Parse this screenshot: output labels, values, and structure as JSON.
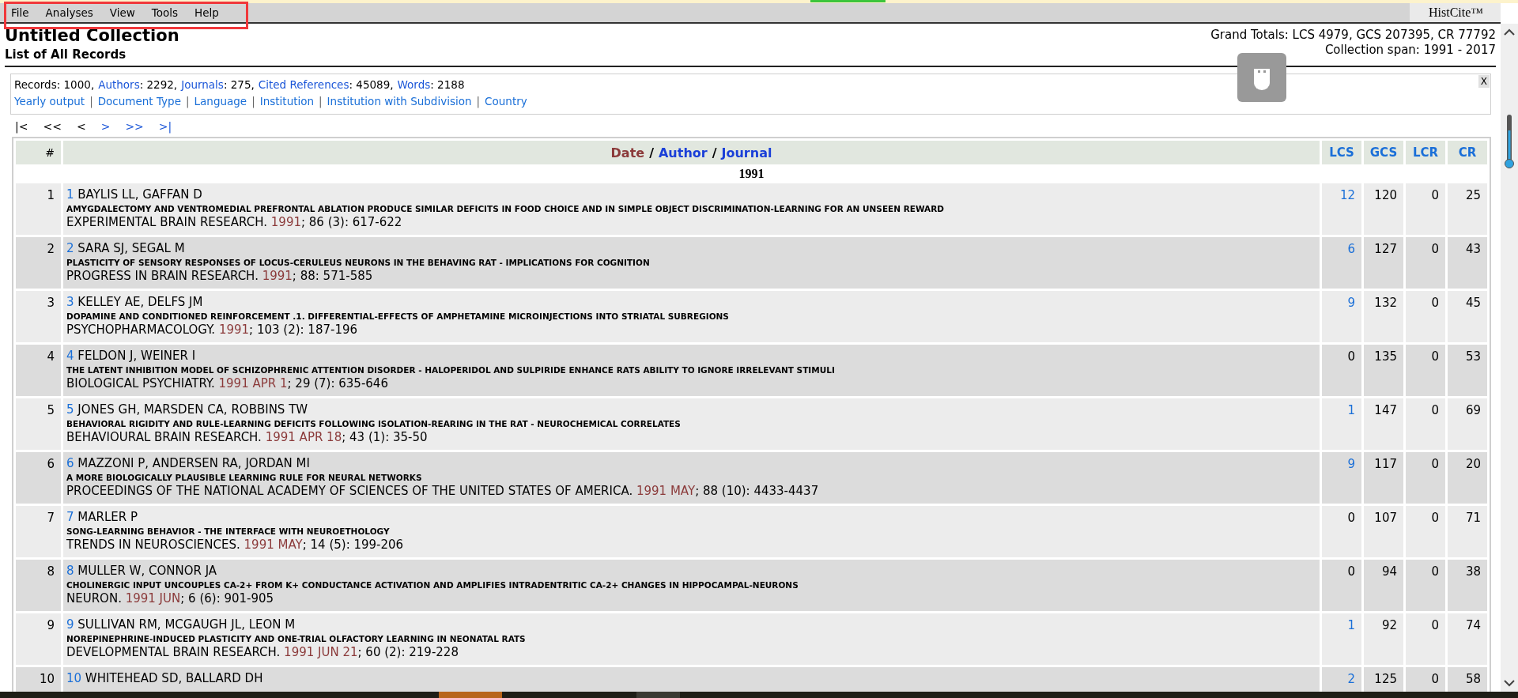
{
  "menu": [
    "File",
    "Analyses",
    "View",
    "Tools",
    "Help"
  ],
  "app_name": "HistCite™",
  "title": "Untitled Collection",
  "subtitle": "List of All Records",
  "grand_totals": "Grand Totals: LCS 4979, GCS 207395, CR 77792",
  "collection_span": "Collection span: 1991 - 2017",
  "summary": [
    {
      "label": "Records",
      "value": ": 1000,",
      "link": false
    },
    {
      "label": "Authors",
      "value": ": 2292,",
      "link": true
    },
    {
      "label": "Journals",
      "value": ": 275,",
      "link": true
    },
    {
      "label": "Cited References",
      "value": ": 45089,",
      "link": true
    },
    {
      "label": "Words",
      "value": ": 2188",
      "link": true
    }
  ],
  "view_separator": "|",
  "sort_separator": "/",
  "views": [
    "Yearly output",
    "Document Type",
    "Language",
    "Institution",
    "Institution with Subdivision",
    "Country"
  ],
  "close_label": "X",
  "pager": [
    {
      "label": "|<",
      "enabled": false
    },
    {
      "label": "<<",
      "enabled": false
    },
    {
      "label": "<",
      "enabled": false
    },
    {
      "label": ">",
      "enabled": true
    },
    {
      "label": ">>",
      "enabled": true
    },
    {
      "label": ">|",
      "enabled": true
    }
  ],
  "table": {
    "number_header": "#",
    "sort_keys": [
      {
        "label": "Date",
        "selected": true
      },
      {
        "label": "Author",
        "selected": false
      },
      {
        "label": "Journal",
        "selected": false
      }
    ],
    "metric_headers": [
      "LCS",
      "GCS",
      "LCR",
      "CR"
    ],
    "group": "1991",
    "rows": [
      {
        "num": "1",
        "id": "1",
        "authors": "BAYLIS LL, GAFFAN D",
        "title": "AMYGDALECTOMY AND VENTROMEDIAL PREFRONTAL ABLATION PRODUCE SIMILAR DEFICITS IN FOOD CHOICE AND IN SIMPLE OBJECT DISCRIMINATION-LEARNING FOR AN UNSEEN REWARD",
        "journal": "EXPERIMENTAL BRAIN RESEARCH.",
        "date": "1991",
        "pages": "; 86 (3): 617-622",
        "lcs": "12",
        "lcs_linked": true,
        "gcs": "120",
        "lcr": "0",
        "cr": "25"
      },
      {
        "num": "2",
        "id": "2",
        "authors": "SARA SJ, SEGAL M",
        "title": "PLASTICITY OF SENSORY RESPONSES OF LOCUS-CERULEUS NEURONS IN THE BEHAVING RAT - IMPLICATIONS FOR COGNITION",
        "journal": "PROGRESS IN BRAIN RESEARCH.",
        "date": "1991",
        "pages": "; 88: 571-585",
        "lcs": "6",
        "lcs_linked": true,
        "gcs": "127",
        "lcr": "0",
        "cr": "43"
      },
      {
        "num": "3",
        "id": "3",
        "authors": "KELLEY AE, DELFS JM",
        "title": "DOPAMINE AND CONDITIONED REINFORCEMENT .1. DIFFERENTIAL-EFFECTS OF AMPHETAMINE MICROINJECTIONS INTO STRIATAL SUBREGIONS",
        "journal": "PSYCHOPHARMACOLOGY.",
        "date": "1991",
        "pages": "; 103 (2): 187-196",
        "lcs": "9",
        "lcs_linked": true,
        "gcs": "132",
        "lcr": "0",
        "cr": "45"
      },
      {
        "num": "4",
        "id": "4",
        "authors": "FELDON J, WEINER I",
        "title": "THE LATENT INHIBITION MODEL OF SCHIZOPHRENIC ATTENTION DISORDER - HALOPERIDOL AND SULPIRIDE ENHANCE RATS ABILITY TO IGNORE IRRELEVANT STIMULI",
        "journal": "BIOLOGICAL PSYCHIATRY.",
        "date": "1991 APR 1",
        "pages": "; 29 (7): 635-646",
        "lcs": "0",
        "lcs_linked": false,
        "gcs": "135",
        "lcr": "0",
        "cr": "53"
      },
      {
        "num": "5",
        "id": "5",
        "authors": "JONES GH, MARSDEN CA, ROBBINS TW",
        "title": "BEHAVIORAL RIGIDITY AND RULE-LEARNING DEFICITS FOLLOWING ISOLATION-REARING IN THE RAT - NEUROCHEMICAL CORRELATES",
        "journal": "BEHAVIOURAL BRAIN RESEARCH.",
        "date": "1991 APR 18",
        "pages": "; 43 (1): 35-50",
        "lcs": "1",
        "lcs_linked": true,
        "gcs": "147",
        "lcr": "0",
        "cr": "69"
      },
      {
        "num": "6",
        "id": "6",
        "authors": "MAZZONI P, ANDERSEN RA, JORDAN MI",
        "title": "A MORE BIOLOGICALLY PLAUSIBLE LEARNING RULE FOR NEURAL NETWORKS",
        "journal": "PROCEEDINGS OF THE NATIONAL ACADEMY OF SCIENCES OF THE UNITED STATES OF AMERICA.",
        "date": "1991 MAY",
        "pages": "; 88 (10): 4433-4437",
        "lcs": "9",
        "lcs_linked": true,
        "gcs": "117",
        "lcr": "0",
        "cr": "20"
      },
      {
        "num": "7",
        "id": "7",
        "authors": "MARLER P",
        "title": "SONG-LEARNING BEHAVIOR - THE INTERFACE WITH NEUROETHOLOGY",
        "journal": "TRENDS IN NEUROSCIENCES.",
        "date": "1991 MAY",
        "pages": "; 14 (5): 199-206",
        "lcs": "0",
        "lcs_linked": false,
        "gcs": "107",
        "lcr": "0",
        "cr": "71"
      },
      {
        "num": "8",
        "id": "8",
        "authors": "MULLER W, CONNOR JA",
        "title": "CHOLINERGIC INPUT UNCOUPLES CA-2+ FROM K+ CONDUCTANCE ACTIVATION AND AMPLIFIES INTRADENTRITIC CA-2+ CHANGES IN HIPPOCAMPAL-NEURONS",
        "journal": "NEURON.",
        "date": "1991 JUN",
        "pages": "; 6 (6): 901-905",
        "lcs": "0",
        "lcs_linked": false,
        "gcs": "94",
        "lcr": "0",
        "cr": "38"
      },
      {
        "num": "9",
        "id": "9",
        "authors": "SULLIVAN RM, MCGAUGH JL, LEON M",
        "title": "NOREPINEPHRINE-INDUCED PLASTICITY AND ONE-TRIAL OLFACTORY LEARNING IN NEONATAL RATS",
        "journal": "DEVELOPMENTAL BRAIN RESEARCH.",
        "date": "1991 JUN 21",
        "pages": "; 60 (2): 219-228",
        "lcs": "1",
        "lcs_linked": true,
        "gcs": "92",
        "lcr": "0",
        "cr": "74"
      },
      {
        "num": "10",
        "id": "10",
        "authors": "WHITEHEAD SD, BALLARD DH",
        "lcs": "2",
        "lcs_linked": true,
        "gcs": "125",
        "lcr": "0",
        "cr": "58"
      }
    ]
  }
}
